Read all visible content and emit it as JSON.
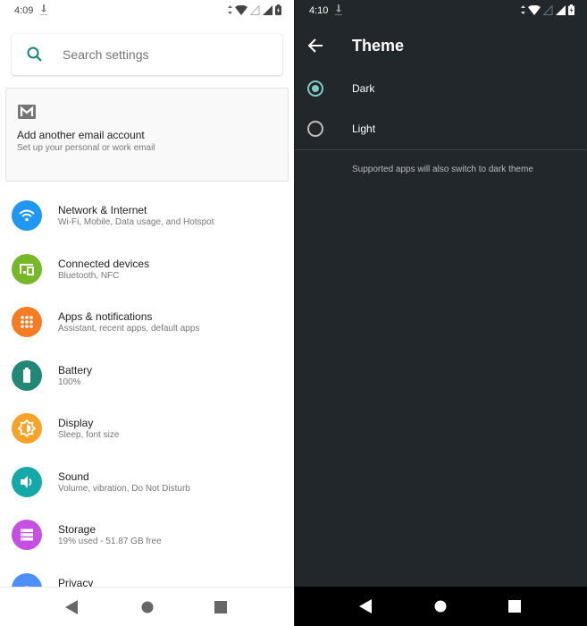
{
  "left": {
    "status": {
      "time": "4:09"
    },
    "search": {
      "placeholder": "Search settings"
    },
    "suggestion": {
      "title": "Add another email account",
      "subtitle": "Set up your personal or work email"
    },
    "items": [
      {
        "title": "Network & Internet",
        "subtitle": "Wi-Fi, Mobile, Data usage, and Hotspot",
        "icon": "wifi-icon",
        "color": "#2196f3"
      },
      {
        "title": "Connected devices",
        "subtitle": "Bluetooth, NFC",
        "icon": "devices-icon",
        "color": "#76b82a"
      },
      {
        "title": "Apps & notifications",
        "subtitle": "Assistant, recent apps, default apps",
        "icon": "apps-icon",
        "color": "#f57c22"
      },
      {
        "title": "Battery",
        "subtitle": "100%",
        "icon": "battery-icon",
        "color": "#238778"
      },
      {
        "title": "Display",
        "subtitle": "Sleep, font size",
        "icon": "brightness-icon",
        "color": "#f8a227"
      },
      {
        "title": "Sound",
        "subtitle": "Volume, vibration, Do Not Disturb",
        "icon": "volume-icon",
        "color": "#16a8a8"
      },
      {
        "title": "Storage",
        "subtitle": "19% used - 51.87 GB free",
        "icon": "storage-icon",
        "color": "#c451e1"
      },
      {
        "title": "Privacy",
        "subtitle": "",
        "icon": "privacy-icon",
        "color": "#4e8ef7"
      }
    ]
  },
  "right": {
    "status": {
      "time": "4:10"
    },
    "appbar": {
      "title": "Theme"
    },
    "options": [
      {
        "label": "Dark",
        "selected": true
      },
      {
        "label": "Light",
        "selected": false
      }
    ],
    "note": "Supported apps will also switch to dark theme",
    "accent": "#80cbc4"
  }
}
